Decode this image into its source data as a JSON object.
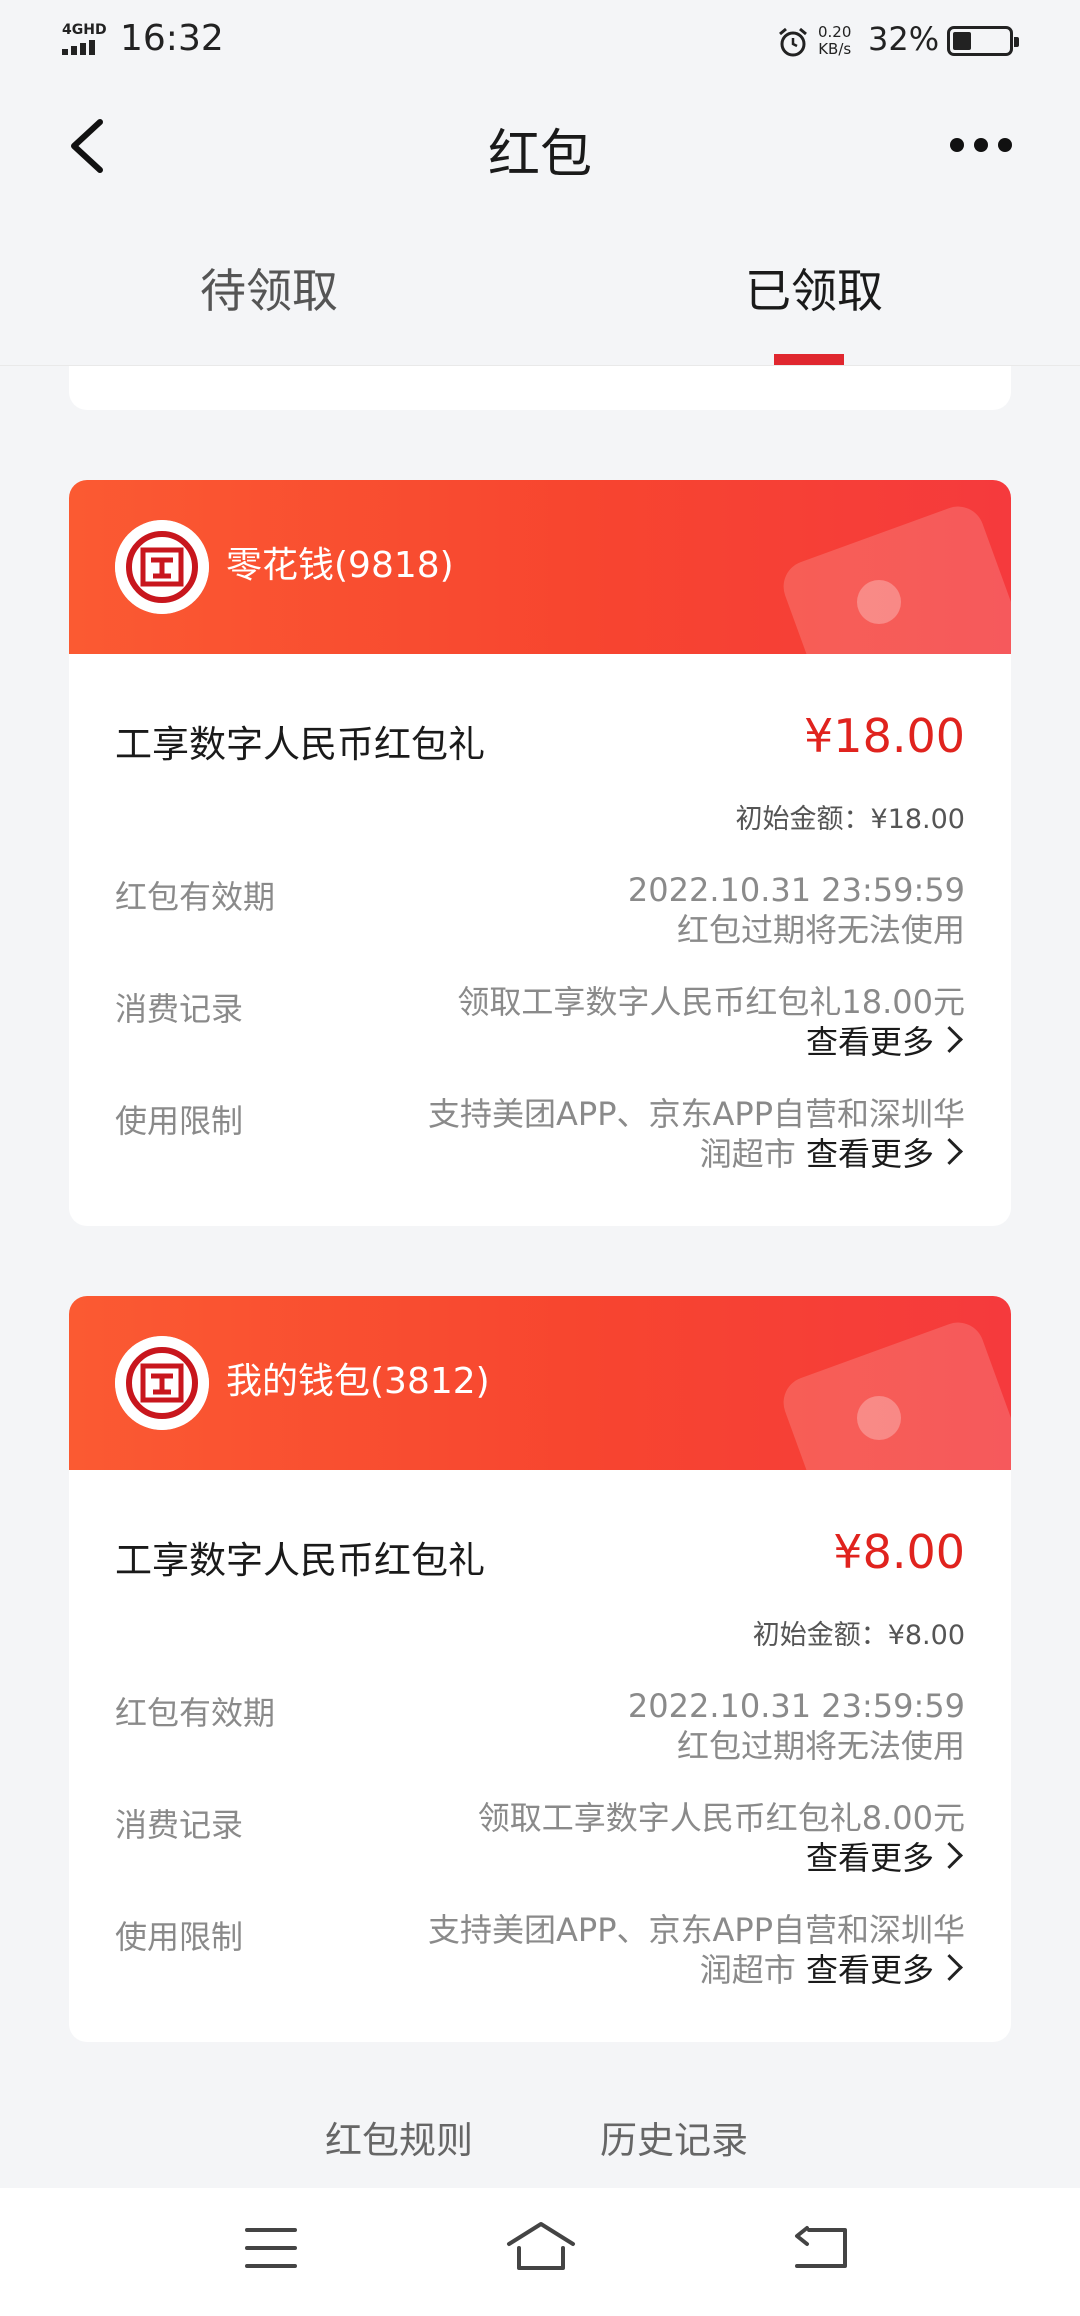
{
  "status_bar": {
    "network": "4GHD",
    "time": "16:32",
    "speed_value": "0.20",
    "speed_unit": "KB/s",
    "battery": "32%"
  },
  "header": {
    "title": "红包"
  },
  "tabs": [
    {
      "label": "待领取",
      "active": false
    },
    {
      "label": "已领取",
      "active": true
    }
  ],
  "accent_color": "#e0231e",
  "cards": [
    {
      "wallet": "零花钱(9818)",
      "title": "工享数字人民币红包礼",
      "amount": "¥18.00",
      "initial": "初始金额：¥18.00",
      "validity_label": "红包有效期",
      "validity_line1": "2022.10.31 23:59:59",
      "validity_line2": "红包过期将无法使用",
      "record_label": "消费记录",
      "record_line1": "领取工享数字人民币红包礼18.00元",
      "record_more": "查看更多",
      "limit_label": "使用限制",
      "limit_line1": "支持美团APP、京东APP自营和深圳华",
      "limit_line2": "润超市",
      "limit_more": "查看更多"
    },
    {
      "wallet": "我的钱包(3812)",
      "title": "工享数字人民币红包礼",
      "amount": "¥8.00",
      "initial": "初始金额：¥8.00",
      "validity_label": "红包有效期",
      "validity_line1": "2022.10.31 23:59:59",
      "validity_line2": "红包过期将无法使用",
      "record_label": "消费记录",
      "record_line1": "领取工享数字人民币红包礼8.00元",
      "record_more": "查看更多",
      "limit_label": "使用限制",
      "limit_line1": "支持美团APP、京东APP自营和深圳华",
      "limit_line2": "润超市",
      "limit_more": "查看更多"
    }
  ],
  "footer": {
    "rules": "红包规则",
    "history": "历史记录"
  },
  "nav_icons": [
    "menu-icon",
    "home-icon",
    "back-icon"
  ]
}
